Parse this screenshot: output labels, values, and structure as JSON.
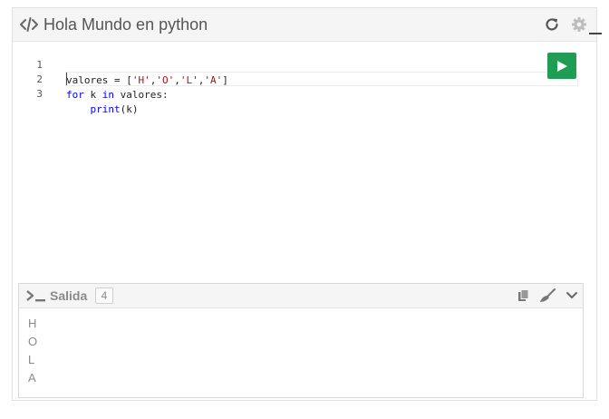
{
  "header": {
    "title": "Hola Mundo en python",
    "icons": {
      "code": "code-icon",
      "refresh": "refresh-icon",
      "settings": "gear-icon"
    }
  },
  "editor": {
    "lines": [
      {
        "number": "1",
        "parts": [
          {
            "t": "valores = [",
            "c": ""
          },
          {
            "t": "'H'",
            "c": "str"
          },
          {
            "t": ",",
            "c": ""
          },
          {
            "t": "'O'",
            "c": "str"
          },
          {
            "t": ",",
            "c": ""
          },
          {
            "t": "'L'",
            "c": "str"
          },
          {
            "t": ",",
            "c": ""
          },
          {
            "t": "'A'",
            "c": "str"
          },
          {
            "t": "]",
            "c": ""
          }
        ]
      },
      {
        "number": "2",
        "parts": [
          {
            "t": "for",
            "c": "kw"
          },
          {
            "t": " k ",
            "c": ""
          },
          {
            "t": "in",
            "c": "kw"
          },
          {
            "t": " valores:",
            "c": ""
          }
        ]
      },
      {
        "number": "3",
        "parts": [
          {
            "t": "    ",
            "c": ""
          },
          {
            "t": "print",
            "c": "kw"
          },
          {
            "t": "(k)",
            "c": ""
          }
        ]
      }
    ],
    "current_line": 3,
    "run_icon": "play-icon"
  },
  "output": {
    "title": "Salida",
    "count": "4",
    "lines": [
      "H",
      "O",
      "L",
      "A"
    ],
    "icons": {
      "prompt": "terminal-prompt-icon",
      "copy": "copy-icon",
      "clear": "broom-icon",
      "collapse": "chevron-down-icon"
    }
  },
  "colors": {
    "run_button": "#1f9d55",
    "keyword": "#0000ff",
    "string": "#a31515"
  }
}
